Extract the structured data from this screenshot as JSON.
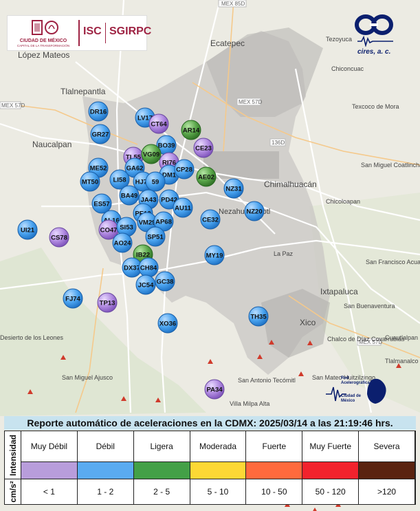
{
  "map": {
    "places": [
      {
        "name": "López Mateos"
      },
      {
        "name": "Tlalnepantla"
      },
      {
        "name": "Ecatepec"
      },
      {
        "name": "Naucalpan"
      },
      {
        "name": "Chimalhuacán"
      },
      {
        "name": "San Miguel Coatlinchán"
      },
      {
        "name": "Texcoco de Mora"
      },
      {
        "name": "Chiconcuac"
      },
      {
        "name": "Tezoyuca"
      },
      {
        "name": "Chicoloapan"
      },
      {
        "name": "San Francisco Acuautla"
      },
      {
        "name": "Ixtapaluca"
      },
      {
        "name": "San Buenaventura"
      },
      {
        "name": "Xico"
      },
      {
        "name": "Chalco de Díaz Covarrubias"
      },
      {
        "name": "San Antonio Tecómitl"
      },
      {
        "name": "Villa Milpa Alta"
      },
      {
        "name": "San Miguel Ajusco"
      },
      {
        "name": "Tlalmanalco"
      },
      {
        "name": "San Mateo Huitzilzingo"
      },
      {
        "name": "La Paz"
      },
      {
        "name": "Cuautlalpan"
      },
      {
        "name": "Desierto de los Leones"
      },
      {
        "name": "Nezahualcóyotl"
      }
    ],
    "road_labels": [
      "MEX 85D",
      "MEX 57D",
      "MEX 57D",
      "136D",
      "MEX 57D"
    ],
    "stations": [
      {
        "id": "DR16",
        "intensity": "Débil"
      },
      {
        "id": "LV17",
        "intensity": "Débil"
      },
      {
        "id": "CT64",
        "intensity": "Muy Débil"
      },
      {
        "id": "AR14",
        "intensity": "Ligera"
      },
      {
        "id": "GR27",
        "intensity": "Débil"
      },
      {
        "id": "BO39",
        "intensity": "Débil"
      },
      {
        "id": "CE23",
        "intensity": "Muy Débil"
      },
      {
        "id": "TL55",
        "intensity": "Muy Débil"
      },
      {
        "id": "VG09",
        "intensity": "Ligera"
      },
      {
        "id": "RI76",
        "intensity": "Muy Débil"
      },
      {
        "id": "ME52",
        "intensity": "Débil"
      },
      {
        "id": "GA62",
        "intensity": "Débil"
      },
      {
        "id": "DM1",
        "intensity": "Débil"
      },
      {
        "id": "CP28",
        "intensity": "Débil"
      },
      {
        "id": "AE02",
        "intensity": "Ligera"
      },
      {
        "id": "MT50",
        "intensity": "Débil"
      },
      {
        "id": "LI58",
        "intensity": "Débil"
      },
      {
        "id": "HJ72",
        "intensity": "Débil"
      },
      {
        "id": "59",
        "intensity": "Débil"
      },
      {
        "id": "NZ31",
        "intensity": "Débil"
      },
      {
        "id": "BA49",
        "intensity": "Débil"
      },
      {
        "id": "JA43",
        "intensity": "Débil"
      },
      {
        "id": "PD42",
        "intensity": "Débil"
      },
      {
        "id": "ES57",
        "intensity": "Débil"
      },
      {
        "id": "AU11",
        "intensity": "Débil"
      },
      {
        "id": "NZ20",
        "intensity": "Débil"
      },
      {
        "id": "AL16",
        "intensity": "Débil"
      },
      {
        "id": "PE10",
        "intensity": "Débil"
      },
      {
        "id": "UI21",
        "intensity": "Débil"
      },
      {
        "id": "CO47",
        "intensity": "Muy Débil"
      },
      {
        "id": "SI53",
        "intensity": "Débil"
      },
      {
        "id": "VM29",
        "intensity": "Débil"
      },
      {
        "id": "AP68",
        "intensity": "Débil"
      },
      {
        "id": "CE32",
        "intensity": "Débil"
      },
      {
        "id": "CS78",
        "intensity": "Muy Débil"
      },
      {
        "id": "SP51",
        "intensity": "Débil"
      },
      {
        "id": "AO24",
        "intensity": "Débil"
      },
      {
        "id": "MY19",
        "intensity": "Débil"
      },
      {
        "id": "IB22",
        "intensity": "Ligera"
      },
      {
        "id": "DX37",
        "intensity": "Débil"
      },
      {
        "id": "CH84",
        "intensity": "Débil"
      },
      {
        "id": "GC38",
        "intensity": "Débil"
      },
      {
        "id": "JC54",
        "intensity": "Débil"
      },
      {
        "id": "FJ74",
        "intensity": "Débil"
      },
      {
        "id": "TP13",
        "intensity": "Muy Débil"
      },
      {
        "id": "TH35",
        "intensity": "Débil"
      },
      {
        "id": "XO36",
        "intensity": "Débil"
      },
      {
        "id": "PA34",
        "intensity": "Muy Débil"
      }
    ]
  },
  "logos": {
    "cdmx_line1": "CIUDAD DE MÉXICO",
    "cdmx_line2": "CAPITAL DE LA TRANSFORMACIÓN",
    "isc": "ISC",
    "sgirpc": "SGIRPC",
    "cires": "cires, a. c.",
    "racm": [
      "Red",
      "Acelerográfica",
      "Ciudad de",
      "México"
    ]
  },
  "report": {
    "title": "Reporte automático de aceleraciones en la CDMX: 2025/03/14 a las 21:19:46 hrs."
  },
  "legend": {
    "row_label_intensity": "Intensidad",
    "row_label_units": "cm/s²",
    "categories": [
      {
        "label": "Muy Débil",
        "range": "< 1",
        "color": "#b89ddb"
      },
      {
        "label": "Débil",
        "range": "1 - 2",
        "color": "#5aabf0"
      },
      {
        "label": "Ligera",
        "range": "2 - 5",
        "color": "#43a047"
      },
      {
        "label": "Moderada",
        "range": "5 - 10",
        "color": "#fdd835"
      },
      {
        "label": "Fuerte",
        "range": "10 - 50",
        "color": "#ff6a3d"
      },
      {
        "label": "Muy Fuerte",
        "range": "50 - 120",
        "color": "#f2232d"
      },
      {
        "label": "Severa",
        "range": ">120",
        "color": "#5a2310"
      }
    ]
  }
}
